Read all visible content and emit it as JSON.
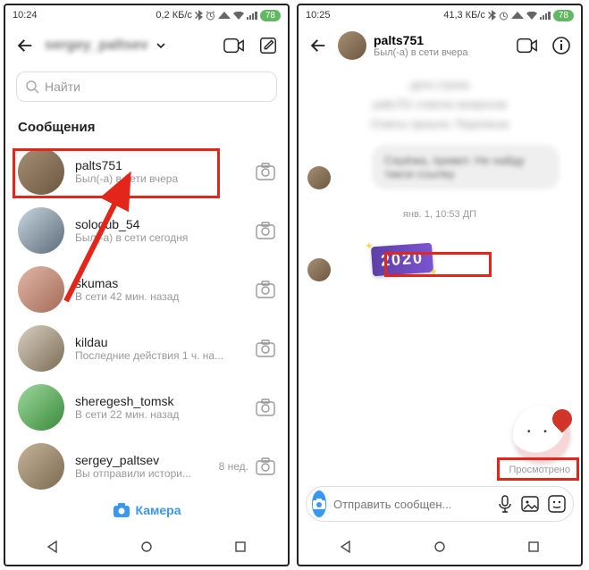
{
  "left": {
    "status": {
      "time": "10:24",
      "net": "0,2 КБ/с",
      "battery": "78"
    },
    "header": {
      "blurred_title": "sergey_paltsev"
    },
    "search": {
      "placeholder": "Найти"
    },
    "section_title": "Сообщения",
    "camera_cta": "Камера",
    "chats": [
      {
        "name": "palts751",
        "sub": "Был(-а) в сети вчера",
        "trail": ""
      },
      {
        "name": "sologub_54",
        "sub": "Был(-а) в сети сегодня",
        "trail": ""
      },
      {
        "name": "skumas",
        "sub": "В сети 42 мин. назад",
        "trail": ""
      },
      {
        "name": "kildau",
        "sub": "Последние действия 1 ч. на...",
        "trail": ""
      },
      {
        "name": "sheregesh_tomsk",
        "sub": "В сети 22 мин. назад",
        "trail": ""
      },
      {
        "name": "sergey_paltsev",
        "sub": "Вы отправили истори...",
        "trail": "8 нед."
      }
    ]
  },
  "right": {
    "status": {
      "time": "10:25",
      "net": "41,3 КБ/с",
      "battery": "78"
    },
    "header": {
      "name": "palts751",
      "sub": "Был(-а) в сети вчера"
    },
    "timestamp": "янв. 1, 10:53 ДП",
    "sticker_text": "2020",
    "seen_label": "Просмотрено",
    "composer": {
      "placeholder": "Отправить сообщен..."
    },
    "blurred_lines": [
      "дата строка",
      "palts751 ответил вопросом",
      "Ответы прошли. Переписка"
    ],
    "bubble_text": "Серёжа, привет. Не найду такси ссылку"
  }
}
